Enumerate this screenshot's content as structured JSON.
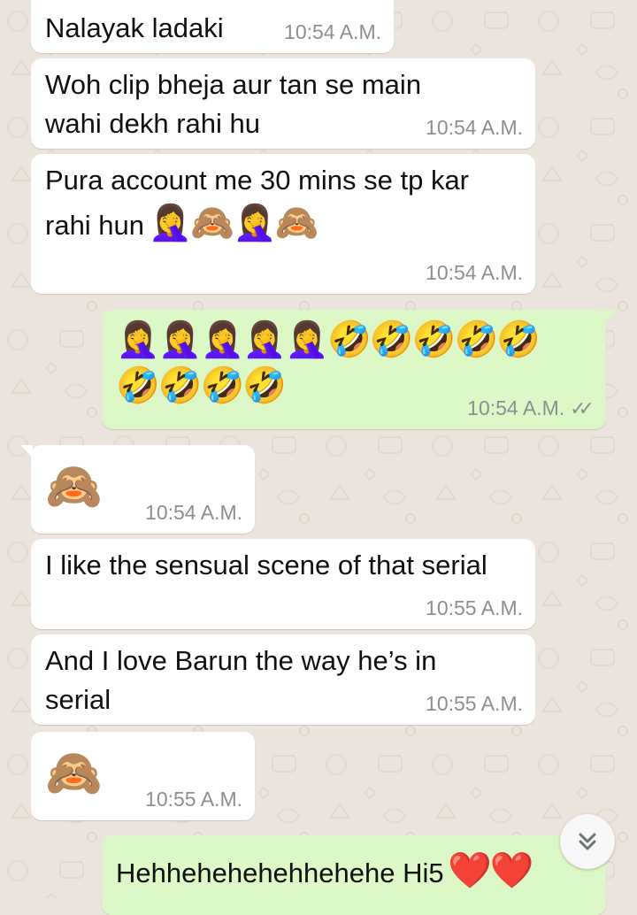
{
  "messages": [
    {
      "id": "m1",
      "dir": "in",
      "text": "Nalayak ladaki",
      "time": "10:54 A.M."
    },
    {
      "id": "m2",
      "dir": "in",
      "text": "Woh clip bheja aur tan se main wahi dekh rahi hu",
      "time": "10:54 A.M."
    },
    {
      "id": "m3",
      "dir": "in",
      "text": "Pura account me 30 mins se tp kar rahi hun",
      "emoji": "🤦‍♀️🙈🤦‍♀️🙈",
      "time": "10:54 A.M."
    },
    {
      "id": "m4",
      "dir": "out",
      "emoji_line1": "🤦‍♀️🤦‍♀️🤦‍♀️🤦‍♀️🤦‍♀️🤣🤣🤣🤣🤣",
      "emoji_line2": "🤣🤣🤣🤣",
      "time": "10:54 A.M.",
      "status": "read"
    },
    {
      "id": "m5",
      "dir": "in",
      "emoji": "🙈",
      "time": "10:54 A.M."
    },
    {
      "id": "m6",
      "dir": "in",
      "text": "I like the sensual scene of that serial",
      "time": "10:55 A.M."
    },
    {
      "id": "m7",
      "dir": "in",
      "text": "And I love Barun the way he’s in serial",
      "time": "10:55 A.M."
    },
    {
      "id": "m8",
      "dir": "in",
      "emoji": "🙈",
      "time": "10:55 A.M."
    },
    {
      "id": "m9",
      "dir": "out",
      "text": "Hehhehehehehhehehe Hi5",
      "emoji": "❤️❤️"
    }
  ],
  "icons": {
    "scroll_down": "chevron-double-down-icon",
    "read_status": "double-check-icon"
  },
  "colors": {
    "incoming": "#FFFFFF",
    "outgoing": "#DCF8C6",
    "background": "#ECE5DD",
    "timestamp": "#8A8F92"
  }
}
